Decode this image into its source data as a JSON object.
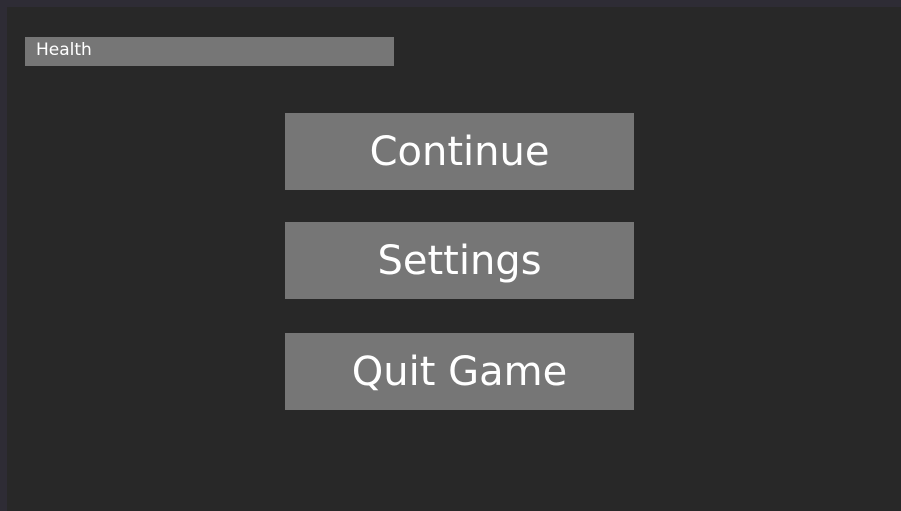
{
  "hud": {
    "health_label": "Health"
  },
  "pause_menu": {
    "continue_label": "Continue",
    "settings_label": "Settings",
    "quit_label": "Quit Game"
  },
  "colors": {
    "window_border": "#2e2c35",
    "background": "#282828",
    "button_fill": "#767676",
    "text": "#ffffff"
  }
}
